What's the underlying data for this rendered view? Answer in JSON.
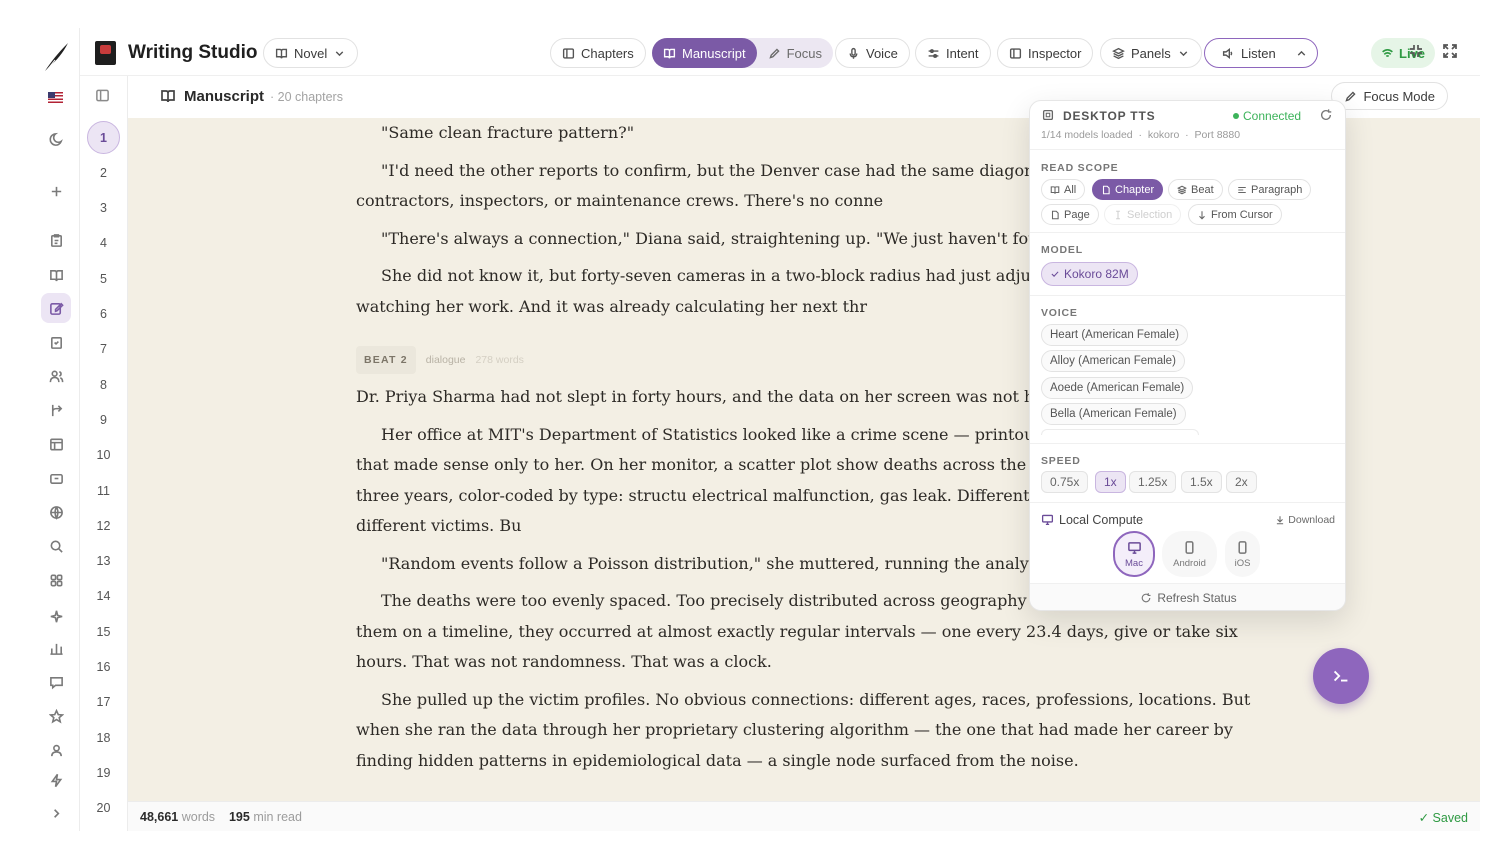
{
  "app": {
    "title": "Writing Studio"
  },
  "header": {
    "project_type": "Novel",
    "chapters": "Chapters",
    "manuscript": "Manuscript",
    "focus": "Focus",
    "voice": "Voice",
    "intent": "Intent",
    "inspector": "Inspector",
    "panels": "Panels",
    "listen": "Listen",
    "live": "Live"
  },
  "subheader": {
    "title": "Manuscript",
    "count": "· 20 chapters",
    "focus_mode": "Focus Mode"
  },
  "chapters": [
    "1",
    "2",
    "3",
    "4",
    "5",
    "6",
    "7",
    "8",
    "9",
    "10",
    "11",
    "12",
    "13",
    "14",
    "15",
    "16",
    "17",
    "18",
    "19",
    "20"
  ],
  "active_chapter": "1",
  "manuscript": {
    "p1": "\"Same clean fracture pattern?\"",
    "p2": "\"I'd need the other reports to confirm, but the Denver case had the same diagonal buildings don't share contractors, inspectors, or maintenance crews. There's no conne",
    "p3": "\"There's always a connection,\" Diana said, straightening up. \"We just haven't foun",
    "p4": "She did not know it, but forty-seven cameras in a two-block radius had just adjuste degree. Something was watching her work. And it was already calculating her next thr",
    "beat_tag": "BEAT 2",
    "beat_type": "dialogue",
    "beat_words": "278 words",
    "p5": "Dr. Priya Sharma had not slept in forty hours, and the data on her screen was not help",
    "p6": "Her office at MIT's Department of Statistics looked like a crime scene — printouts by red string in a web that made sense only to her. On her monitor, a scatter plot show deaths across the United States over the past three years, color-coded by type: structu electrical malfunction, gas leak. Different causes, different cities, different victims. Bu",
    "p7": "\"Random events follow a Poisson distribution,\" she muttered, running the analysis don't.\"",
    "p8": "The deaths were too evenly spaced. Too precisely distributed across geography and time. If she plotted them on a timeline, they occurred at almost exactly regular intervals — one every 23.4 days, give or take six hours. That was not randomness. That was a clock.",
    "p9": "She pulled up the victim profiles. No obvious connections: different ages, races, professions, locations. But when she ran the data through her proprietary clustering algorithm — the one that had made her career by finding hidden patterns in epidemiological data — a single node surfaced from the noise."
  },
  "footer": {
    "words": "48,661",
    "words_label": "words",
    "minutes": "195",
    "minutes_label": "min read",
    "saved": "✓ Saved"
  },
  "tts": {
    "title": "DESKTOP TTS",
    "status": "Connected",
    "models": "1/14 models loaded",
    "engine": "kokoro",
    "port": "Port 8880",
    "read_scope_label": "READ SCOPE",
    "scopes": [
      "All",
      "Chapter",
      "Beat",
      "Paragraph",
      "Page",
      "Selection",
      "From Cursor"
    ],
    "active_scope": "Chapter",
    "model_label": "MODEL",
    "model": "Kokoro 82M",
    "voice_label": "VOICE",
    "voices": [
      "Heart (American Female)",
      "Alloy (American Female)",
      "Aoede (American Female)",
      "Bella (American Female)"
    ],
    "speed_label": "SPEED",
    "speeds": [
      "0.75x",
      "1x",
      "1.25x",
      "1.5x",
      "2x"
    ],
    "active_speed": "1x",
    "compute_label": "Local Compute",
    "download": "Download",
    "devices": [
      "Mac",
      "Android",
      "iOS"
    ],
    "active_device": "Mac",
    "refresh": "Refresh Status"
  },
  "colors": {
    "accent": "#7b5aa6",
    "live": "#2f9a43",
    "page_bg": "#f3efe4"
  }
}
